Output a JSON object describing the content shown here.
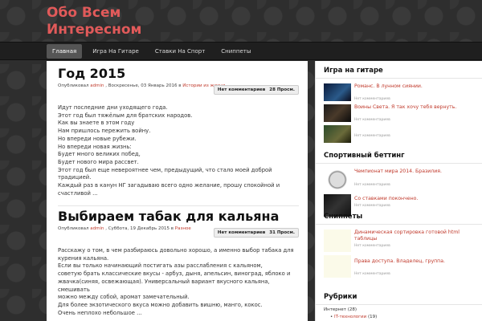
{
  "site": {
    "title_line1": "Обо Всем",
    "title_line2": "Интересном"
  },
  "nav": {
    "items": [
      "Главная",
      "Игра На Гитаре",
      "Ставки На Спорт",
      "Сниппеты"
    ]
  },
  "posts": [
    {
      "title": "Год 2015",
      "meta_prefix": "Опубликовал",
      "author": "admin",
      "date": ", Воскресенье, 03 Январь 2016 в",
      "category": "Истории из жизни",
      "comments": "Нет комментариев",
      "views": "28 Просм.",
      "lines": [
        "Идут последние дни уходящего года.",
        "Этот год был тяжёлым для братских народов.",
        "Как вы знаете в этом году",
        "Нам пришлось пережить войну.",
        "Но впереди новые рубежи.",
        "Но впереди новая жизнь:",
        "Будет много великих побед,",
        "Будет нового мира рассвет.",
        "Этот год был еще невероятнее чем, предыдущий, что стало моей доброй традицией.",
        "Каждый раз в канун НГ загадываю всего одно желание, прошу спокойной и",
        "счастливой ..."
      ]
    },
    {
      "title": "Выбираем табак для кальяна",
      "meta_prefix": "Опубликовал",
      "author": "admin",
      "date": ", Суббота, 19 Декабрь 2015 в",
      "category": "Разное",
      "comments": "Нет комментариев",
      "views": "31 Просм.",
      "lines": [
        "Расскажу о том, в чем разбираюсь довольно хорошо, а именно выбор табака для",
        "курения кальяна.",
        "Если вы только начинающий постигать азы расслабления с кальяном,",
        "советую брать классические вкусы - арбуз, дыня, апельсин, виноград, яблоко и",
        "жвачка(синяя, освежающая). Универсальный вариант вкусного кальяна, смешивать",
        "можно между собой, аромат замечательный.",
        "Для более экзотического вкуса можно добавить вишню, манго, кокос.",
        "Очень неплохо небольшое ..."
      ]
    }
  ],
  "sidebar": {
    "guitar": {
      "title": "Игра на гитаре",
      "items": [
        {
          "link": "Романс. В лунном сиянии.",
          "sub": "Нет комментариев"
        },
        {
          "link": "Воины Света. Я так хочу тебя вернуть.",
          "sub": "Нет комментариев"
        },
        {
          "link": "",
          "sub": "Нет комментариев"
        }
      ]
    },
    "betting": {
      "title": "Спортивный беттинг",
      "items": [
        {
          "link": "Чемпионат мира 2014. Бразилия.",
          "sub": "Нет комментариев"
        },
        {
          "link": "Со ставками покончено.",
          "sub": "Нет комментариев"
        }
      ]
    },
    "snippets": {
      "title": "Сниппеты",
      "items": [
        {
          "link": "Динамическая сортировка готовой html таблицы",
          "sub": "Нет комментариев"
        },
        {
          "link": "Права доступа. Владелец, группа.",
          "sub": "Нет комментариев"
        }
      ]
    },
    "rubrics": {
      "title": "Рубрики",
      "items": [
        {
          "label": "Интернет",
          "count": "(28)"
        },
        {
          "label": "IT-технологии",
          "count": "(19)"
        }
      ]
    }
  }
}
